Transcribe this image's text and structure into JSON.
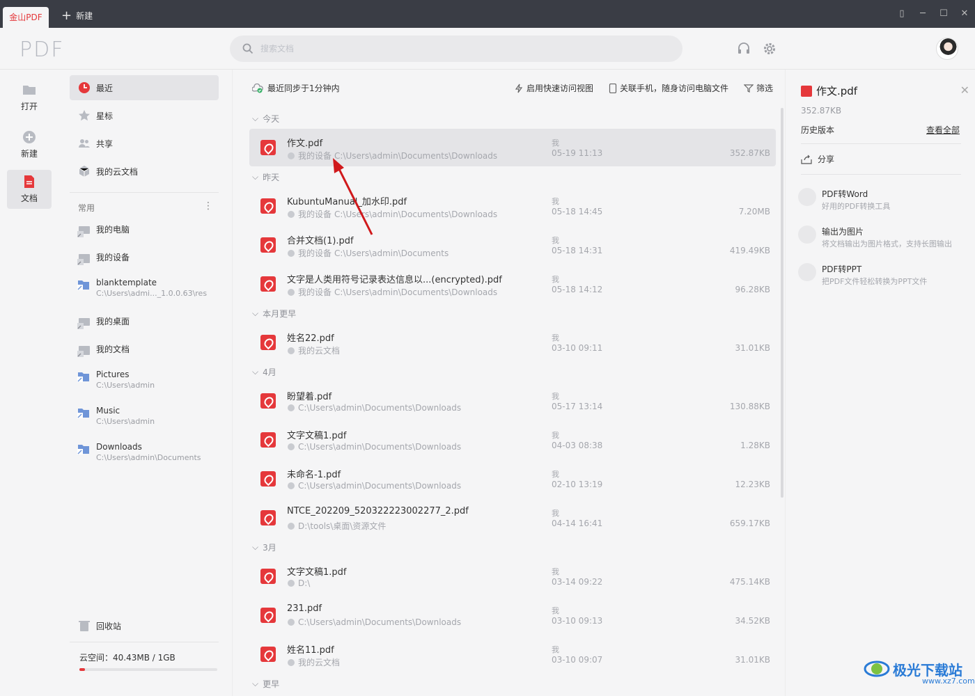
{
  "titlebar": {
    "active_tab": "金山PDF",
    "new_tab_label": "新建"
  },
  "header": {
    "logo": "PDF",
    "search_placeholder": "搜索文档"
  },
  "rail": {
    "open": "打开",
    "new": "新建",
    "docs": "文档"
  },
  "sidebar": {
    "nav": [
      "最近",
      "星标",
      "共享",
      "我的云文档"
    ],
    "section_label": "常用",
    "favorites": [
      {
        "title": "我的电脑",
        "sub": ""
      },
      {
        "title": "我的设备",
        "sub": ""
      },
      {
        "title": "blanktemplate",
        "sub": "C:\\Users\\admi..._1.0.0.63\\res"
      },
      {
        "title": "我的桌面",
        "sub": ""
      },
      {
        "title": "我的文档",
        "sub": ""
      },
      {
        "title": "Pictures",
        "sub": "C:\\Users\\admin"
      },
      {
        "title": "Music",
        "sub": "C:\\Users\\admin"
      },
      {
        "title": "Downloads",
        "sub": "C:\\Users\\admin\\Documents"
      }
    ],
    "recycle": "回收站",
    "cloud_space": "云空间：40.43MB / 1GB",
    "cloud_used_fraction": 0.04
  },
  "toolbar": {
    "sync": "最近同步于1分钟内",
    "quick_view": "启用快速访问视图",
    "phone": "关联手机，随身访问电脑文件",
    "filter": "筛选"
  },
  "groups": [
    "今天",
    "昨天",
    "本月更早",
    "4月",
    "3月",
    "更早"
  ],
  "files": [
    {
      "name": "作文.pdf",
      "device": "我的设备",
      "path": "C:\\Users\\admin\\Documents\\Downloads",
      "owner": "我",
      "time": "05-19 11:13",
      "size": "352.87KB"
    },
    {
      "name": "KubuntuManual_加水印.pdf",
      "device": "我的设备",
      "path": "C:\\Users\\admin\\Documents\\Downloads",
      "owner": "我",
      "time": "05-18 14:45",
      "size": "7.20MB"
    },
    {
      "name": "合并文档(1).pdf",
      "device": "我的设备",
      "path": "C:\\Users\\admin\\Documents",
      "owner": "我",
      "time": "05-18 14:31",
      "size": "419.49KB"
    },
    {
      "name": "文字是人类用符号记录表达信息以...(encrypted).pdf",
      "device": "我的设备",
      "path": "C:\\Users\\admin\\Documents\\Downloads",
      "owner": "我",
      "time": "05-18 14:12",
      "size": "96.28KB"
    },
    {
      "name": "姓名22.pdf",
      "device": "",
      "path": "我的云文档",
      "owner": "我",
      "time": "03-10 09:11",
      "size": "31.01KB"
    },
    {
      "name": "盼望着.pdf",
      "device": "",
      "path": "C:\\Users\\admin\\Documents\\Downloads",
      "owner": "我",
      "time": "05-17 13:14",
      "size": "130.88KB"
    },
    {
      "name": "文字文稿1.pdf",
      "device": "",
      "path": "C:\\Users\\admin\\Documents\\Downloads",
      "owner": "我",
      "time": "04-03 08:38",
      "size": "1.28KB"
    },
    {
      "name": "未命名-1.pdf",
      "device": "",
      "path": "C:\\Users\\admin\\Documents\\Downloads",
      "owner": "我",
      "time": "02-10 13:19",
      "size": "12.23KB"
    },
    {
      "name": "NTCE_202209_520322223002277_2.pdf",
      "device": "",
      "path": "D:\\tools\\桌面\\资源文件",
      "owner": "我",
      "time": "04-14 16:41",
      "size": "659.17KB"
    },
    {
      "name": "文字文稿1.pdf",
      "device": "",
      "path": "D:\\",
      "owner": "我",
      "time": "03-14 09:22",
      "size": "475.14KB"
    },
    {
      "name": "231.pdf",
      "device": "",
      "path": "C:\\Users\\admin\\Documents\\Downloads",
      "owner": "我",
      "time": "03-10 09:13",
      "size": "34.52KB"
    },
    {
      "name": "姓名11.pdf",
      "device": "",
      "path": "我的云文档",
      "owner": "我",
      "time": "03-10 09:07",
      "size": "31.01KB"
    }
  ],
  "panel": {
    "title": "作文.pdf",
    "size": "352.87KB",
    "history": "历史版本",
    "view_all": "查看全部",
    "share": "分享",
    "tools": [
      {
        "title": "PDF转Word",
        "desc": "好用的PDF转换工具"
      },
      {
        "title": "输出为图片",
        "desc": "将文档输出为图片格式，支持长图输出"
      },
      {
        "title": "PDF转PPT",
        "desc": "把PDF文件轻松转换为PPT文件"
      }
    ]
  },
  "watermark": {
    "text": "极光下载站",
    "site": "www.xz7.com"
  },
  "colors": {
    "accent": "#e5383b",
    "titlebar": "#3a3d45",
    "annotation_arrow": "#d0191c"
  }
}
